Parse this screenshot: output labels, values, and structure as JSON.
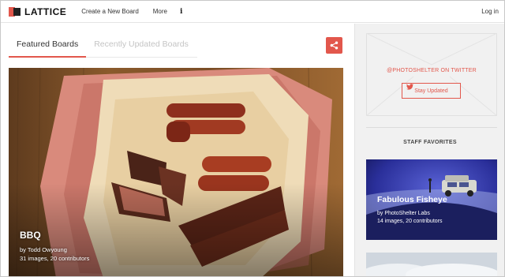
{
  "nav": {
    "brand": "LATTICE",
    "links": [
      "Create a New Board",
      "More"
    ],
    "info_icon": "i",
    "login": "Log in"
  },
  "tabs": [
    {
      "label": "Featured Boards",
      "active": true
    },
    {
      "label": "Recently Updated Boards",
      "active": false
    }
  ],
  "share_icon": "share-icon",
  "hero": {
    "title": "BBQ",
    "author": "by Todd Owyoung",
    "meta": "31 images, 20 contributors"
  },
  "sidebar": {
    "twitter_label": "@PHOTOSHELTER ON TWITTER",
    "stay_button": "Stay Updated",
    "staff_label": "STAFF FAVORITES",
    "favorite": {
      "title": "Fabulous Fisheye",
      "author": "by PhotoShelter Labs",
      "meta": "14 images, 20 contributors"
    }
  },
  "colors": {
    "accent": "#e2574c",
    "sidebar_bg": "#f1f1f1"
  }
}
